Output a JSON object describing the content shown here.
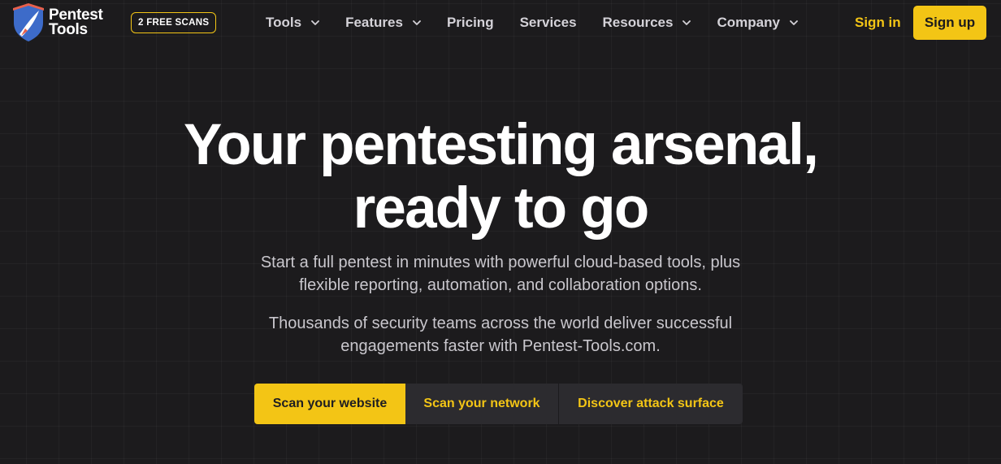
{
  "brand": {
    "name_line1": "Pentest",
    "name_line2": "Tools",
    "logo_colors": {
      "shield": "#3d6bc9",
      "accent": "#e8604c"
    }
  },
  "promo_badge": "2 FREE SCANS",
  "nav": {
    "items": [
      {
        "label": "Tools",
        "has_dropdown": true
      },
      {
        "label": "Features",
        "has_dropdown": true
      },
      {
        "label": "Pricing",
        "has_dropdown": false
      },
      {
        "label": "Services",
        "has_dropdown": false
      },
      {
        "label": "Resources",
        "has_dropdown": true
      },
      {
        "label": "Company",
        "has_dropdown": true
      }
    ],
    "dropdown_icon": "chevron-down-icon",
    "sign_in": "Sign in",
    "sign_up": "Sign up"
  },
  "hero": {
    "title_line1": "Your pentesting arsenal,",
    "title_line2": "ready to go",
    "subtitle1_line1": "Start a full pentest in minutes with powerful cloud-based tools, plus",
    "subtitle1_line2": "flexible reporting, automation, and collaboration options.",
    "subtitle2_line1": "Thousands of security teams across the world deliver successful",
    "subtitle2_line2": "engagements faster with Pentest-Tools.com."
  },
  "cta_tabs": [
    {
      "label": "Scan your website",
      "active": true
    },
    {
      "label": "Scan your network",
      "active": false
    },
    {
      "label": "Discover attack surface",
      "active": false
    }
  ],
  "colors": {
    "background": "#1c1b1d",
    "accent_yellow": "#f3c515",
    "nav_text": "#d4d2d8",
    "body_text": "#c9c7cd"
  }
}
